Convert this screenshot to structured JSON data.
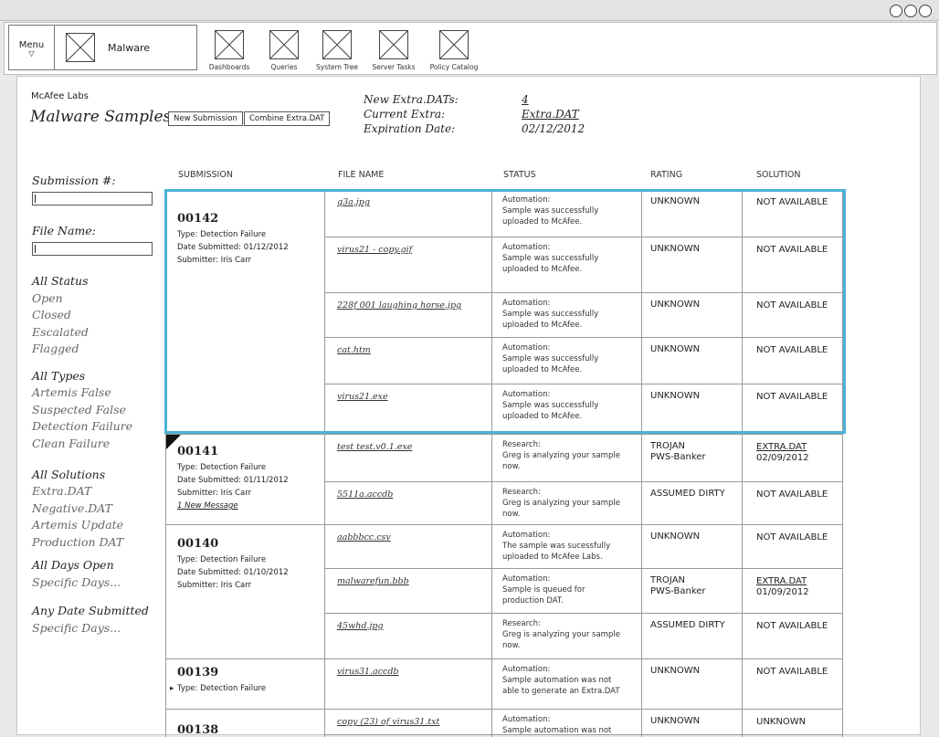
{
  "window": {
    "controls": [
      "circle",
      "circle",
      "circle"
    ]
  },
  "toolbar": {
    "menu_label": "Menu",
    "menu_caret": "▽",
    "app_name": "Malware",
    "items": [
      {
        "label": "Dashboards"
      },
      {
        "label": "Queries"
      },
      {
        "label": "System Tree"
      },
      {
        "label": "Server Tasks"
      },
      {
        "label": "Policy Catalog"
      }
    ]
  },
  "header": {
    "brand": "McAfee Labs",
    "title": "Malware Samples",
    "new_submission": "New Submission",
    "combine_extra_dat": "Combine Extra.DAT",
    "new_extra_dats_label": "New Extra.DATs:",
    "new_extra_dats_value": "4",
    "current_extra_label": "Current Extra:",
    "current_extra_value": "Extra.DAT",
    "expiration_label": "Expiration Date:",
    "expiration_value": "02/12/2012"
  },
  "sidebar": {
    "submission_label": "Submission #:",
    "file_name_label": "File Name:",
    "status_heading": "All Status",
    "status_items": [
      "Open",
      "Closed",
      "Escalated",
      "Flagged"
    ],
    "types_heading": "All Types",
    "types_items": [
      "Artemis False",
      "Suspected False",
      "Detection Failure",
      "Clean Failure"
    ],
    "solutions_heading": "All Solutions",
    "solutions_items": [
      "Extra.DAT",
      "Negative.DAT",
      "Artemis Update",
      "Production DAT"
    ],
    "days_heading": "All Days Open",
    "days_item": "Specific Days...",
    "date_heading": "Any Date Submitted",
    "date_item": "Specific Days..."
  },
  "table": {
    "headers": [
      "SUBMISSION",
      "FILE NAME",
      "STATUS",
      "RATING",
      "SOLUTION"
    ],
    "submissions": [
      {
        "number": "00142",
        "type": "Type: Detection Failure",
        "date": "Date Submitted: 01/12/2012",
        "submitter": "Submitter: Iris Carr"
      },
      {
        "number": "00141",
        "type": "Type: Detection Failure",
        "date": "Date Submitted: 01/11/2012",
        "submitter": "Submitter: Iris Carr",
        "message": "1 New Message"
      },
      {
        "number": "00140",
        "type": "Type: Detection Failure",
        "date": "Date Submitted: 01/10/2012",
        "submitter": "Submitter: Iris Carr"
      },
      {
        "number": "00139",
        "type": "Type: Detection Failure",
        "arrow": "▸"
      },
      {
        "number": "00138"
      }
    ],
    "rows": [
      {
        "file": "q3a.jpg",
        "status": [
          "Automation:",
          "Sample was successfully",
          "uploaded to McAfee."
        ],
        "rating": [
          "UNKNOWN"
        ],
        "solution": [
          "NOT AVAILABLE"
        ]
      },
      {
        "file": "virus21 - copy.gif",
        "status": [
          "Automation:",
          "Sample was successfully",
          "uploaded to McAfee."
        ],
        "rating": [
          "UNKNOWN"
        ],
        "solution": [
          "NOT AVAILABLE"
        ]
      },
      {
        "file": "228f 001 laughing horse.jpg",
        "status": [
          "Automation:",
          "Sample was successfully",
          "uploaded to McAfee."
        ],
        "rating": [
          "UNKNOWN"
        ],
        "solution": [
          "NOT AVAILABLE"
        ]
      },
      {
        "file": "cat.htm",
        "status": [
          "Automation:",
          "Sample was successfully",
          "uploaded to McAfee."
        ],
        "rating": [
          "UNKNOWN"
        ],
        "solution": [
          "NOT AVAILABLE"
        ]
      },
      {
        "file": "virus21.exe",
        "status": [
          "Automation:",
          "Sample was successfully",
          "uploaded to McAfee."
        ],
        "rating": [
          "UNKNOWN"
        ],
        "solution": [
          "NOT AVAILABLE"
        ]
      },
      {
        "file": "test test.v0.1.exe",
        "status": [
          "Research:",
          "Greg is analyzing your sample",
          "now."
        ],
        "rating": [
          "TROJAN",
          "PWS-Banker"
        ],
        "solution": [
          "EXTRA.DAT",
          "02/09/2012"
        ]
      },
      {
        "file": "5511a.accdb",
        "status": [
          "Research:",
          "Greg is analyzing your sample",
          "now."
        ],
        "rating": [
          "ASSUMED DIRTY"
        ],
        "solution": [
          "NOT AVAILABLE"
        ]
      },
      {
        "file": "aabbbcc.csv",
        "status": [
          "Automation:",
          "The sample was sucessfully",
          "uploaded to McAfee Labs."
        ],
        "rating": [
          "UNKNOWN"
        ],
        "solution": [
          "NOT AVAILABLE"
        ]
      },
      {
        "file": "malwarefun.bbb",
        "status": [
          "Automation:",
          "Sample is queued for",
          "production DAT."
        ],
        "rating": [
          "TROJAN",
          "PWS-Banker"
        ],
        "solution": [
          "EXTRA.DAT",
          "01/09/2012"
        ]
      },
      {
        "file": "45whd.jpg",
        "status": [
          "Research:",
          "Greg is analyzing your sample",
          "now."
        ],
        "rating": [
          "ASSUMED DIRTY"
        ],
        "solution": [
          "NOT AVAILABLE"
        ]
      },
      {
        "file": "virus31.accdb",
        "status": [
          "Automation:",
          "Sample automation was not",
          "able to generate an Extra.DAT"
        ],
        "rating": [
          "UNKNOWN"
        ],
        "solution": [
          "NOT AVAILABLE"
        ]
      },
      {
        "file": "copy (23) of virus31.txt",
        "status": [
          "Automation:",
          "Sample automation was not"
        ],
        "rating": [
          "UNKNOWN"
        ],
        "solution": [
          "UNKNOWN"
        ]
      }
    ]
  }
}
